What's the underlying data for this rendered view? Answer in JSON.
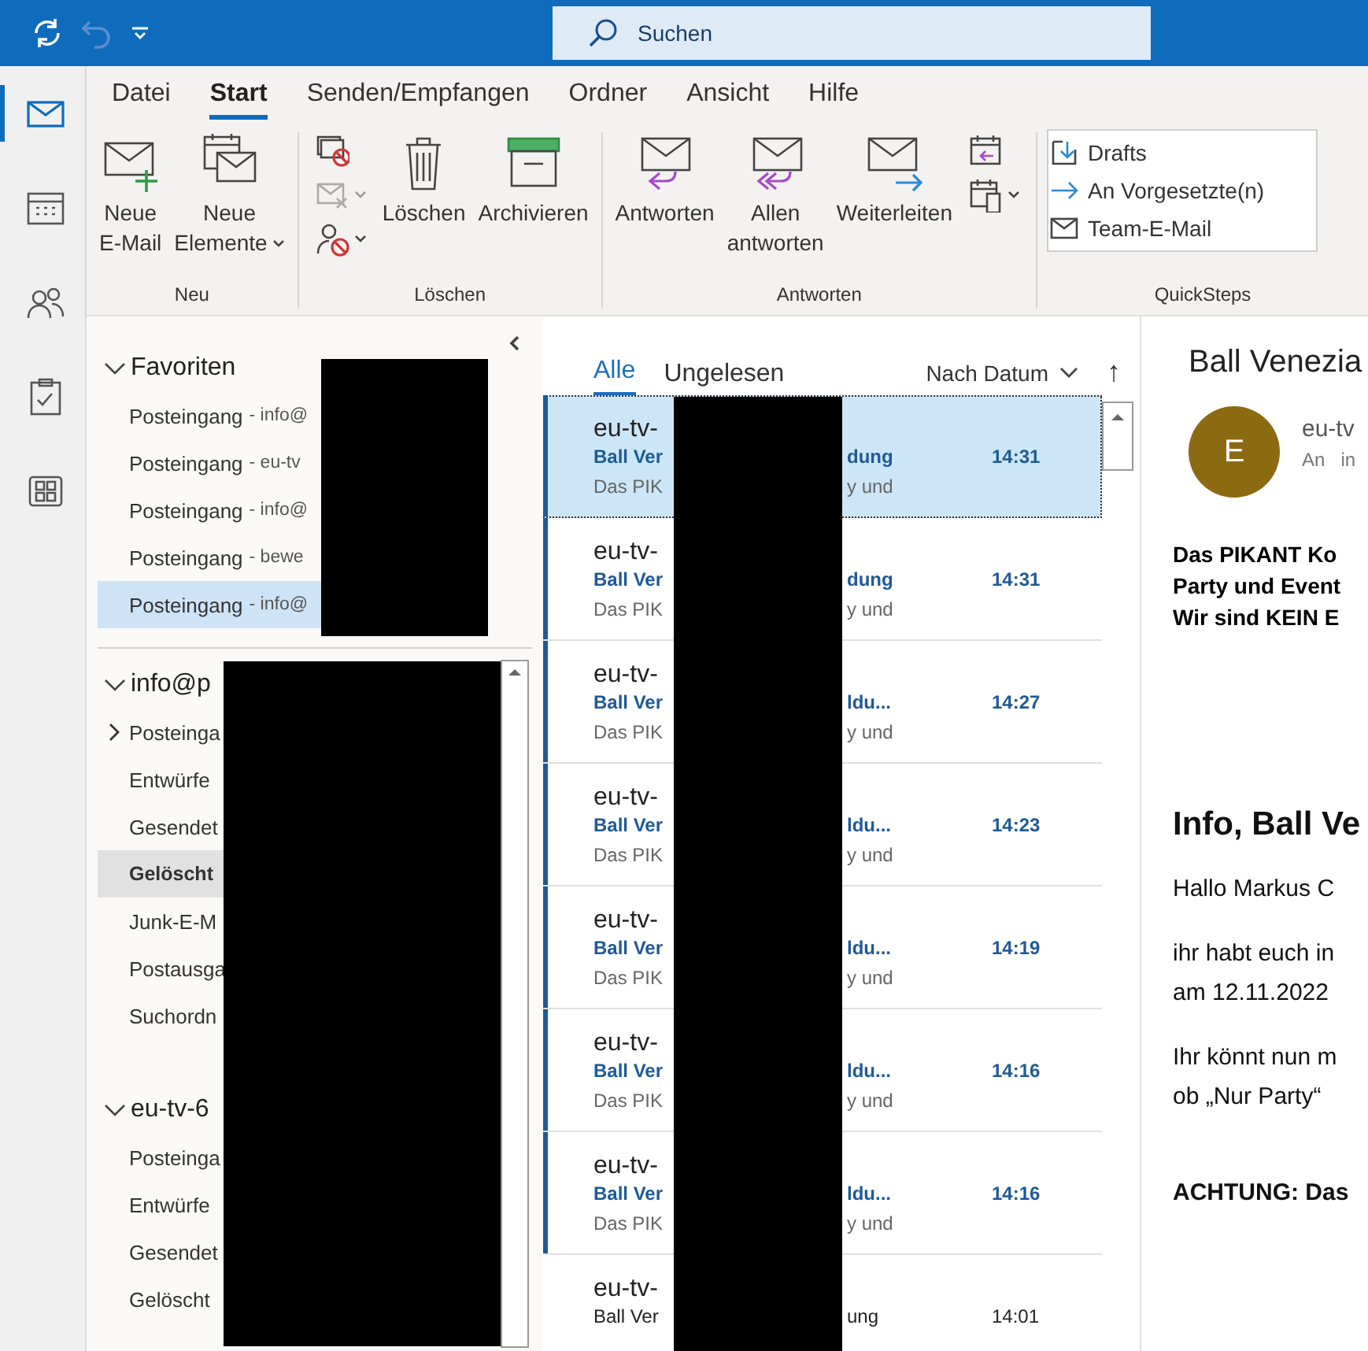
{
  "title_bar": {
    "search": {
      "placeholder": "Suchen"
    }
  },
  "nav_rail": [
    {
      "kind": "mail",
      "selected": true
    },
    {
      "kind": "calendar",
      "selected": false
    },
    {
      "kind": "people",
      "selected": false
    },
    {
      "kind": "tasks",
      "selected": false
    },
    {
      "kind": "apps",
      "selected": false
    }
  ],
  "ribbon_tabs": [
    {
      "label": "Datei",
      "selected": false
    },
    {
      "label": "Start",
      "selected": true
    },
    {
      "label": "Senden/Empfangen",
      "selected": false
    },
    {
      "label": "Ordner",
      "selected": false
    },
    {
      "label": "Ansicht",
      "selected": false
    },
    {
      "label": "Hilfe",
      "selected": false
    }
  ],
  "ribbon_groups": [
    {
      "label": "Neu",
      "items": [
        {
          "kind": "new-mail",
          "lines": [
            "Neue",
            "E-Mail"
          ],
          "dropdown": false
        },
        {
          "kind": "new-items",
          "lines": [
            "Neue",
            "Elemente"
          ],
          "dropdown": true
        }
      ]
    },
    {
      "label": "Löschen",
      "items": [
        {
          "kind": "small-stack",
          "buttons": [
            {
              "kind": "ignore",
              "disabled": false,
              "dropdown": false
            },
            {
              "kind": "cleanup",
              "disabled": true,
              "dropdown": true
            },
            {
              "kind": "junk",
              "disabled": false,
              "dropdown": true
            }
          ]
        },
        {
          "kind": "delete",
          "lines": [
            "Löschen"
          ],
          "dropdown": false
        },
        {
          "kind": "archive",
          "lines": [
            "Archivieren"
          ],
          "dropdown": false
        }
      ]
    },
    {
      "label": "Antworten",
      "items": [
        {
          "kind": "reply",
          "lines": [
            "Antworten"
          ],
          "dropdown": false
        },
        {
          "kind": "reply-all",
          "lines": [
            "Allen",
            "antworten"
          ],
          "dropdown": false
        },
        {
          "kind": "forward",
          "lines": [
            "Weiterleiten"
          ],
          "dropdown": false
        },
        {
          "kind": "small-stack",
          "buttons": [
            {
              "kind": "meeting",
              "disabled": false,
              "dropdown": false
            },
            {
              "kind": "more",
              "disabled": false,
              "dropdown": true
            }
          ]
        }
      ]
    },
    {
      "label": "QuickSteps",
      "items": [
        {
          "kind": "quicksteps",
          "steps": [
            {
              "kind": "drafts",
              "label": "Drafts"
            },
            {
              "kind": "to-manager",
              "label": "An Vorgesetzte(n)"
            },
            {
              "kind": "team-mail",
              "label": "Team-E-Mail"
            }
          ]
        }
      ]
    }
  ],
  "folder_pane": {
    "favorites": {
      "label": "Favoriten",
      "expanded": true,
      "items": [
        {
          "name": "Posteingang",
          "account": "- info@",
          "selected": false
        },
        {
          "name": "Posteingang",
          "account": "- eu-tv",
          "selected": false
        },
        {
          "name": "Posteingang",
          "account": "- info@",
          "selected": false
        },
        {
          "name": "Posteingang",
          "account": "- bewe",
          "selected": false
        },
        {
          "name": "Posteingang",
          "account": "- info@",
          "selected": true
        }
      ]
    },
    "accounts": [
      {
        "label": "info@p",
        "expanded": true,
        "folders": [
          {
            "label": "Posteinga",
            "expandable": true,
            "selected": false
          },
          {
            "label": "Entwürfe",
            "expandable": false,
            "selected": false
          },
          {
            "label": "Gesendet",
            "expandable": false,
            "selected": false
          },
          {
            "label": "Gelöscht",
            "expandable": false,
            "selected": true
          },
          {
            "label": "Junk-E-M",
            "expandable": false,
            "selected": false
          },
          {
            "label": "Postausga",
            "expandable": false,
            "selected": false
          },
          {
            "label": "Suchordn",
            "expandable": false,
            "selected": false
          }
        ]
      },
      {
        "label": "eu-tv-6",
        "expanded": true,
        "folders": [
          {
            "label": "Posteinga",
            "expandable": false,
            "selected": false
          },
          {
            "label": "Entwürfe",
            "expandable": false,
            "selected": false
          },
          {
            "label": "Gesendet",
            "expandable": false,
            "selected": false
          },
          {
            "label": "Gelöscht",
            "expandable": false,
            "selected": false
          }
        ]
      }
    ]
  },
  "message_list": {
    "filters": [
      {
        "label": "Alle",
        "selected": true
      },
      {
        "label": "Ungelesen",
        "selected": false
      }
    ],
    "sort": {
      "label": "Nach Datum",
      "arrow": "↑"
    },
    "messages": [
      {
        "sender": "eu-tv-",
        "subject_start": "Ball Ver",
        "subject_end": "dung",
        "preview_start": "Das PIK",
        "preview_end": "y und",
        "time": "14:31",
        "unread": true,
        "selected": true
      },
      {
        "sender": "eu-tv-",
        "subject_start": "Ball Ver",
        "subject_end": "dung",
        "preview_start": "Das PIK",
        "preview_end": "y und",
        "time": "14:31",
        "unread": true,
        "selected": false
      },
      {
        "sender": "eu-tv-",
        "subject_start": "Ball Ver",
        "subject_end": "ldu...",
        "preview_start": "Das PIK",
        "preview_end": "y und",
        "time": "14:27",
        "unread": true,
        "selected": false
      },
      {
        "sender": "eu-tv-",
        "subject_start": "Ball Ver",
        "subject_end": "ldu...",
        "preview_start": "Das PIK",
        "preview_end": "y und",
        "time": "14:23",
        "unread": true,
        "selected": false
      },
      {
        "sender": "eu-tv-",
        "subject_start": "Ball Ver",
        "subject_end": "ldu...",
        "preview_start": "Das PIK",
        "preview_end": "y und",
        "time": "14:19",
        "unread": true,
        "selected": false
      },
      {
        "sender": "eu-tv-",
        "subject_start": "Ball Ver",
        "subject_end": "ldu...",
        "preview_start": "Das PIK",
        "preview_end": "y und",
        "time": "14:16",
        "unread": true,
        "selected": false
      },
      {
        "sender": "eu-tv-",
        "subject_start": "Ball Ver",
        "subject_end": "ldu...",
        "preview_start": "Das PIK",
        "preview_end": "y und",
        "time": "14:16",
        "unread": true,
        "selected": false
      },
      {
        "sender": "eu-tv-",
        "subject_start": "Ball Ver",
        "subject_end": "ung",
        "time": "14:01",
        "unread": false,
        "selected": false
      }
    ]
  },
  "reading_pane": {
    "subject": "Ball Venezia",
    "avatar_letter": "E",
    "sender": "eu-tv",
    "to_label": "An",
    "to": "in",
    "banner_lines": [
      "Das PIKANT Ko",
      "Party und Event",
      "Wir sind KEIN E"
    ],
    "heading": "Info, Ball Ve",
    "paragraphs": [
      [
        "Hallo Markus C"
      ],
      [
        "ihr habt euch in",
        "am 12.11.2022"
      ],
      [
        "Ihr könnt nun m",
        "ob „Nur Party“"
      ]
    ],
    "notice": "ACHTUNG: Das"
  }
}
